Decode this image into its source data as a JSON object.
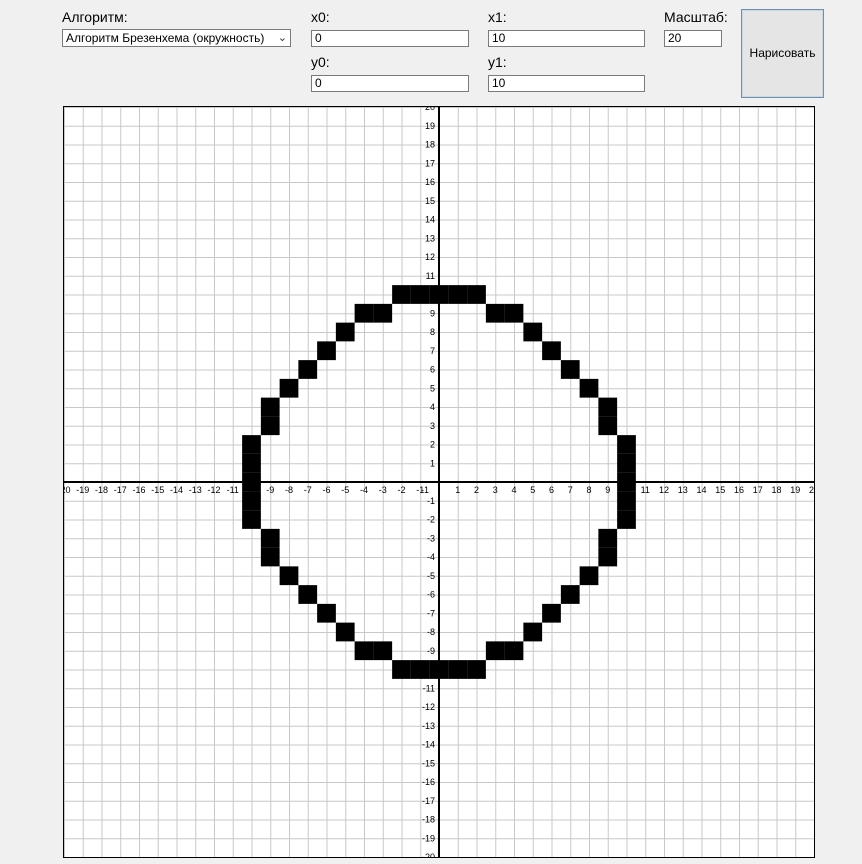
{
  "form": {
    "algorithm_label": "Алгоритм:",
    "algorithm_value": "Алгоритм Брезенхема (окружность)",
    "x0_label": "x0:",
    "x0_value": "0",
    "y0_label": "y0:",
    "y0_value": "0",
    "x1_label": "x1:",
    "x1_value": "10",
    "y1_label": "y1:",
    "y1_value": "10",
    "scale_label": "Масштаб:",
    "scale_value": "20",
    "draw_label": "Нарисовать"
  },
  "chart_data": {
    "type": "raster-grid",
    "xlim": [
      -20,
      20
    ],
    "ylim": [
      -20,
      20
    ],
    "grid": true,
    "grid_color": "#c8c8c8",
    "pixel_color": "#000000",
    "pixels": [
      [
        -2,
        10
      ],
      [
        -1,
        10
      ],
      [
        0,
        10
      ],
      [
        1,
        10
      ],
      [
        2,
        10
      ],
      [
        -4,
        9
      ],
      [
        -3,
        9
      ],
      [
        3,
        9
      ],
      [
        4,
        9
      ],
      [
        -5,
        8
      ],
      [
        5,
        8
      ],
      [
        -6,
        7
      ],
      [
        6,
        7
      ],
      [
        -7,
        6
      ],
      [
        7,
        6
      ],
      [
        -8,
        5
      ],
      [
        8,
        5
      ],
      [
        -9,
        4
      ],
      [
        9,
        4
      ],
      [
        -9,
        3
      ],
      [
        9,
        3
      ],
      [
        -10,
        2
      ],
      [
        10,
        2
      ],
      [
        -10,
        1
      ],
      [
        10,
        1
      ],
      [
        -10,
        0
      ],
      [
        10,
        0
      ],
      [
        -10,
        -1
      ],
      [
        10,
        -1
      ],
      [
        -10,
        -2
      ],
      [
        10,
        -2
      ],
      [
        -9,
        -3
      ],
      [
        9,
        -3
      ],
      [
        -9,
        -4
      ],
      [
        9,
        -4
      ],
      [
        -8,
        -5
      ],
      [
        8,
        -5
      ],
      [
        -7,
        -6
      ],
      [
        7,
        -6
      ],
      [
        -6,
        -7
      ],
      [
        6,
        -7
      ],
      [
        -5,
        -8
      ],
      [
        5,
        -8
      ],
      [
        -4,
        -9
      ],
      [
        -3,
        -9
      ],
      [
        3,
        -9
      ],
      [
        4,
        -9
      ],
      [
        -2,
        -10
      ],
      [
        -1,
        -10
      ],
      [
        0,
        -10
      ],
      [
        1,
        -10
      ],
      [
        2,
        -10
      ]
    ]
  }
}
